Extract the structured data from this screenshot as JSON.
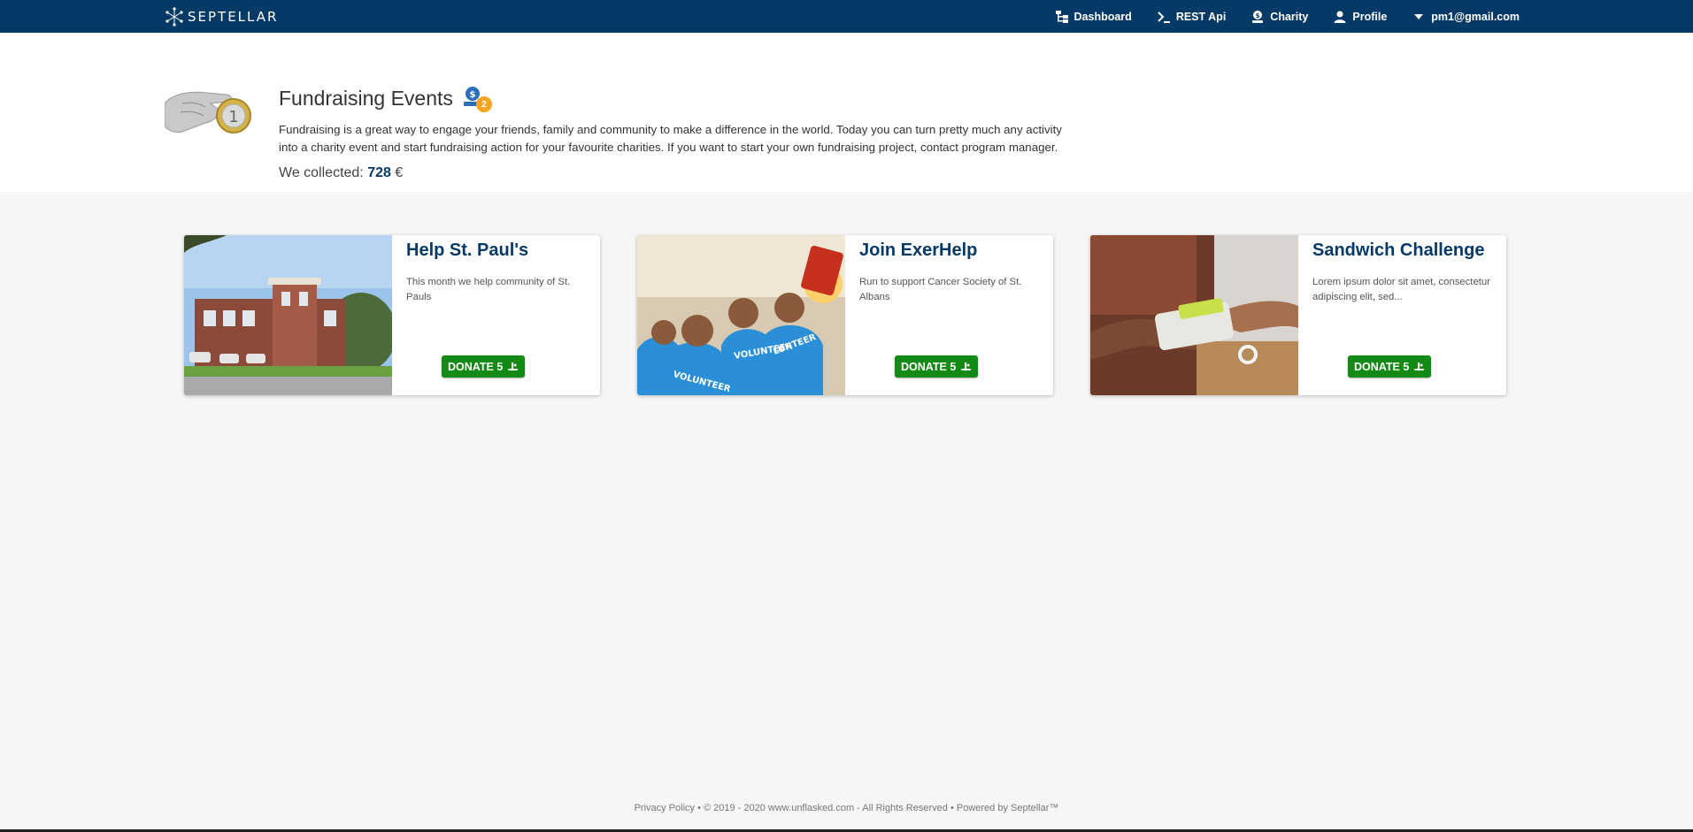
{
  "brand": {
    "name": "SEPTELLAR"
  },
  "nav": {
    "items": [
      {
        "label": "Dashboard",
        "icon": "sitemap-icon"
      },
      {
        "label": "REST Api",
        "icon": "terminal-icon"
      },
      {
        "label": "Charity",
        "icon": "charity-icon"
      },
      {
        "label": "Profile",
        "icon": "user-icon"
      },
      {
        "label": "pm1@gmail.com",
        "icon": "caret-down-icon"
      }
    ]
  },
  "header": {
    "title": "Fundraising Events",
    "badge_count": "2",
    "description": "Fundraising is a great way to engage your friends, family and community to make a difference in the world. Today you can turn pretty much any activity into a charity event and start fundraising action for your favourite charities. If you want to start your own fundraising project, contact program manager.",
    "collected_label": "We collected:",
    "collected_amount": "728",
    "currency": "€"
  },
  "cards": [
    {
      "title": "Help St. Paul's",
      "text": "This month we help community of St. Pauls",
      "button": "DONATE 5"
    },
    {
      "title": "Join ExerHelp",
      "text": "Run to support Cancer Society of St. Albans",
      "button": "DONATE 5"
    },
    {
      "title": "Sandwich Challenge",
      "text": "Lorem ipsum dolor sit amet, consectetur adipiscing elit, sed...",
      "button": "DONATE 5"
    }
  ],
  "footer": {
    "text": "Privacy Policy • © 2019 - 2020 www.unflasked.com - All Rights Reserved • Powered by Septellar™"
  },
  "colors": {
    "navbar": "#063a66",
    "accent": "#063a66",
    "donate": "#138a16",
    "badge": "#f5a623"
  }
}
